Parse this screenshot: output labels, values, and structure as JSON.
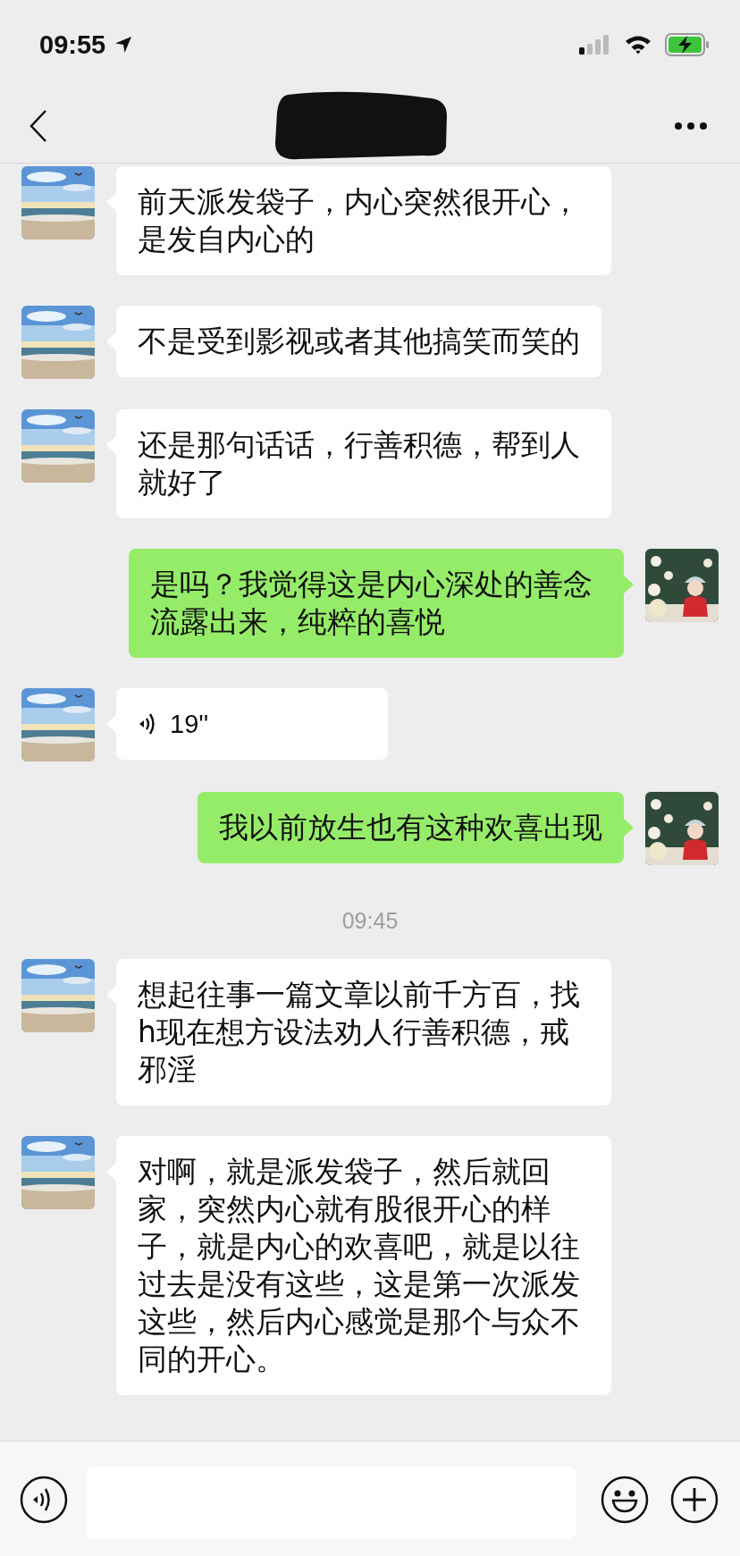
{
  "status_bar": {
    "time": "09:55"
  },
  "messages": [
    {
      "kind": "text",
      "outgoing": false,
      "text": "前天派发袋子，内心突然很开心，是发自内心的"
    },
    {
      "kind": "text",
      "outgoing": false,
      "text": "不是受到影视或者其他搞笑而笑的"
    },
    {
      "kind": "text",
      "outgoing": false,
      "text": "还是那句话话，行善积德，帮到人就好了"
    },
    {
      "kind": "text",
      "outgoing": true,
      "text": "是吗？我觉得这是内心深处的善念流露出来，纯粹的喜悦"
    },
    {
      "kind": "voice",
      "outgoing": false,
      "text": "19''"
    },
    {
      "kind": "text",
      "outgoing": true,
      "text": "我以前放生也有这种欢喜出现"
    },
    {
      "kind": "time",
      "text": "09:45"
    },
    {
      "kind": "text",
      "outgoing": false,
      "text": "想起往事一篇文章以前千方百，找h现在想方设法劝人行善积德，戒邪淫"
    },
    {
      "kind": "text",
      "outgoing": false,
      "text": "对啊，就是派发袋子，然后就回家，突然内心就有股很开心的样子，就是内心的欢喜吧，就是以往过去是没有这些，这是第一次派发这些，然后内心感觉是那个与众不同的开心。"
    }
  ]
}
